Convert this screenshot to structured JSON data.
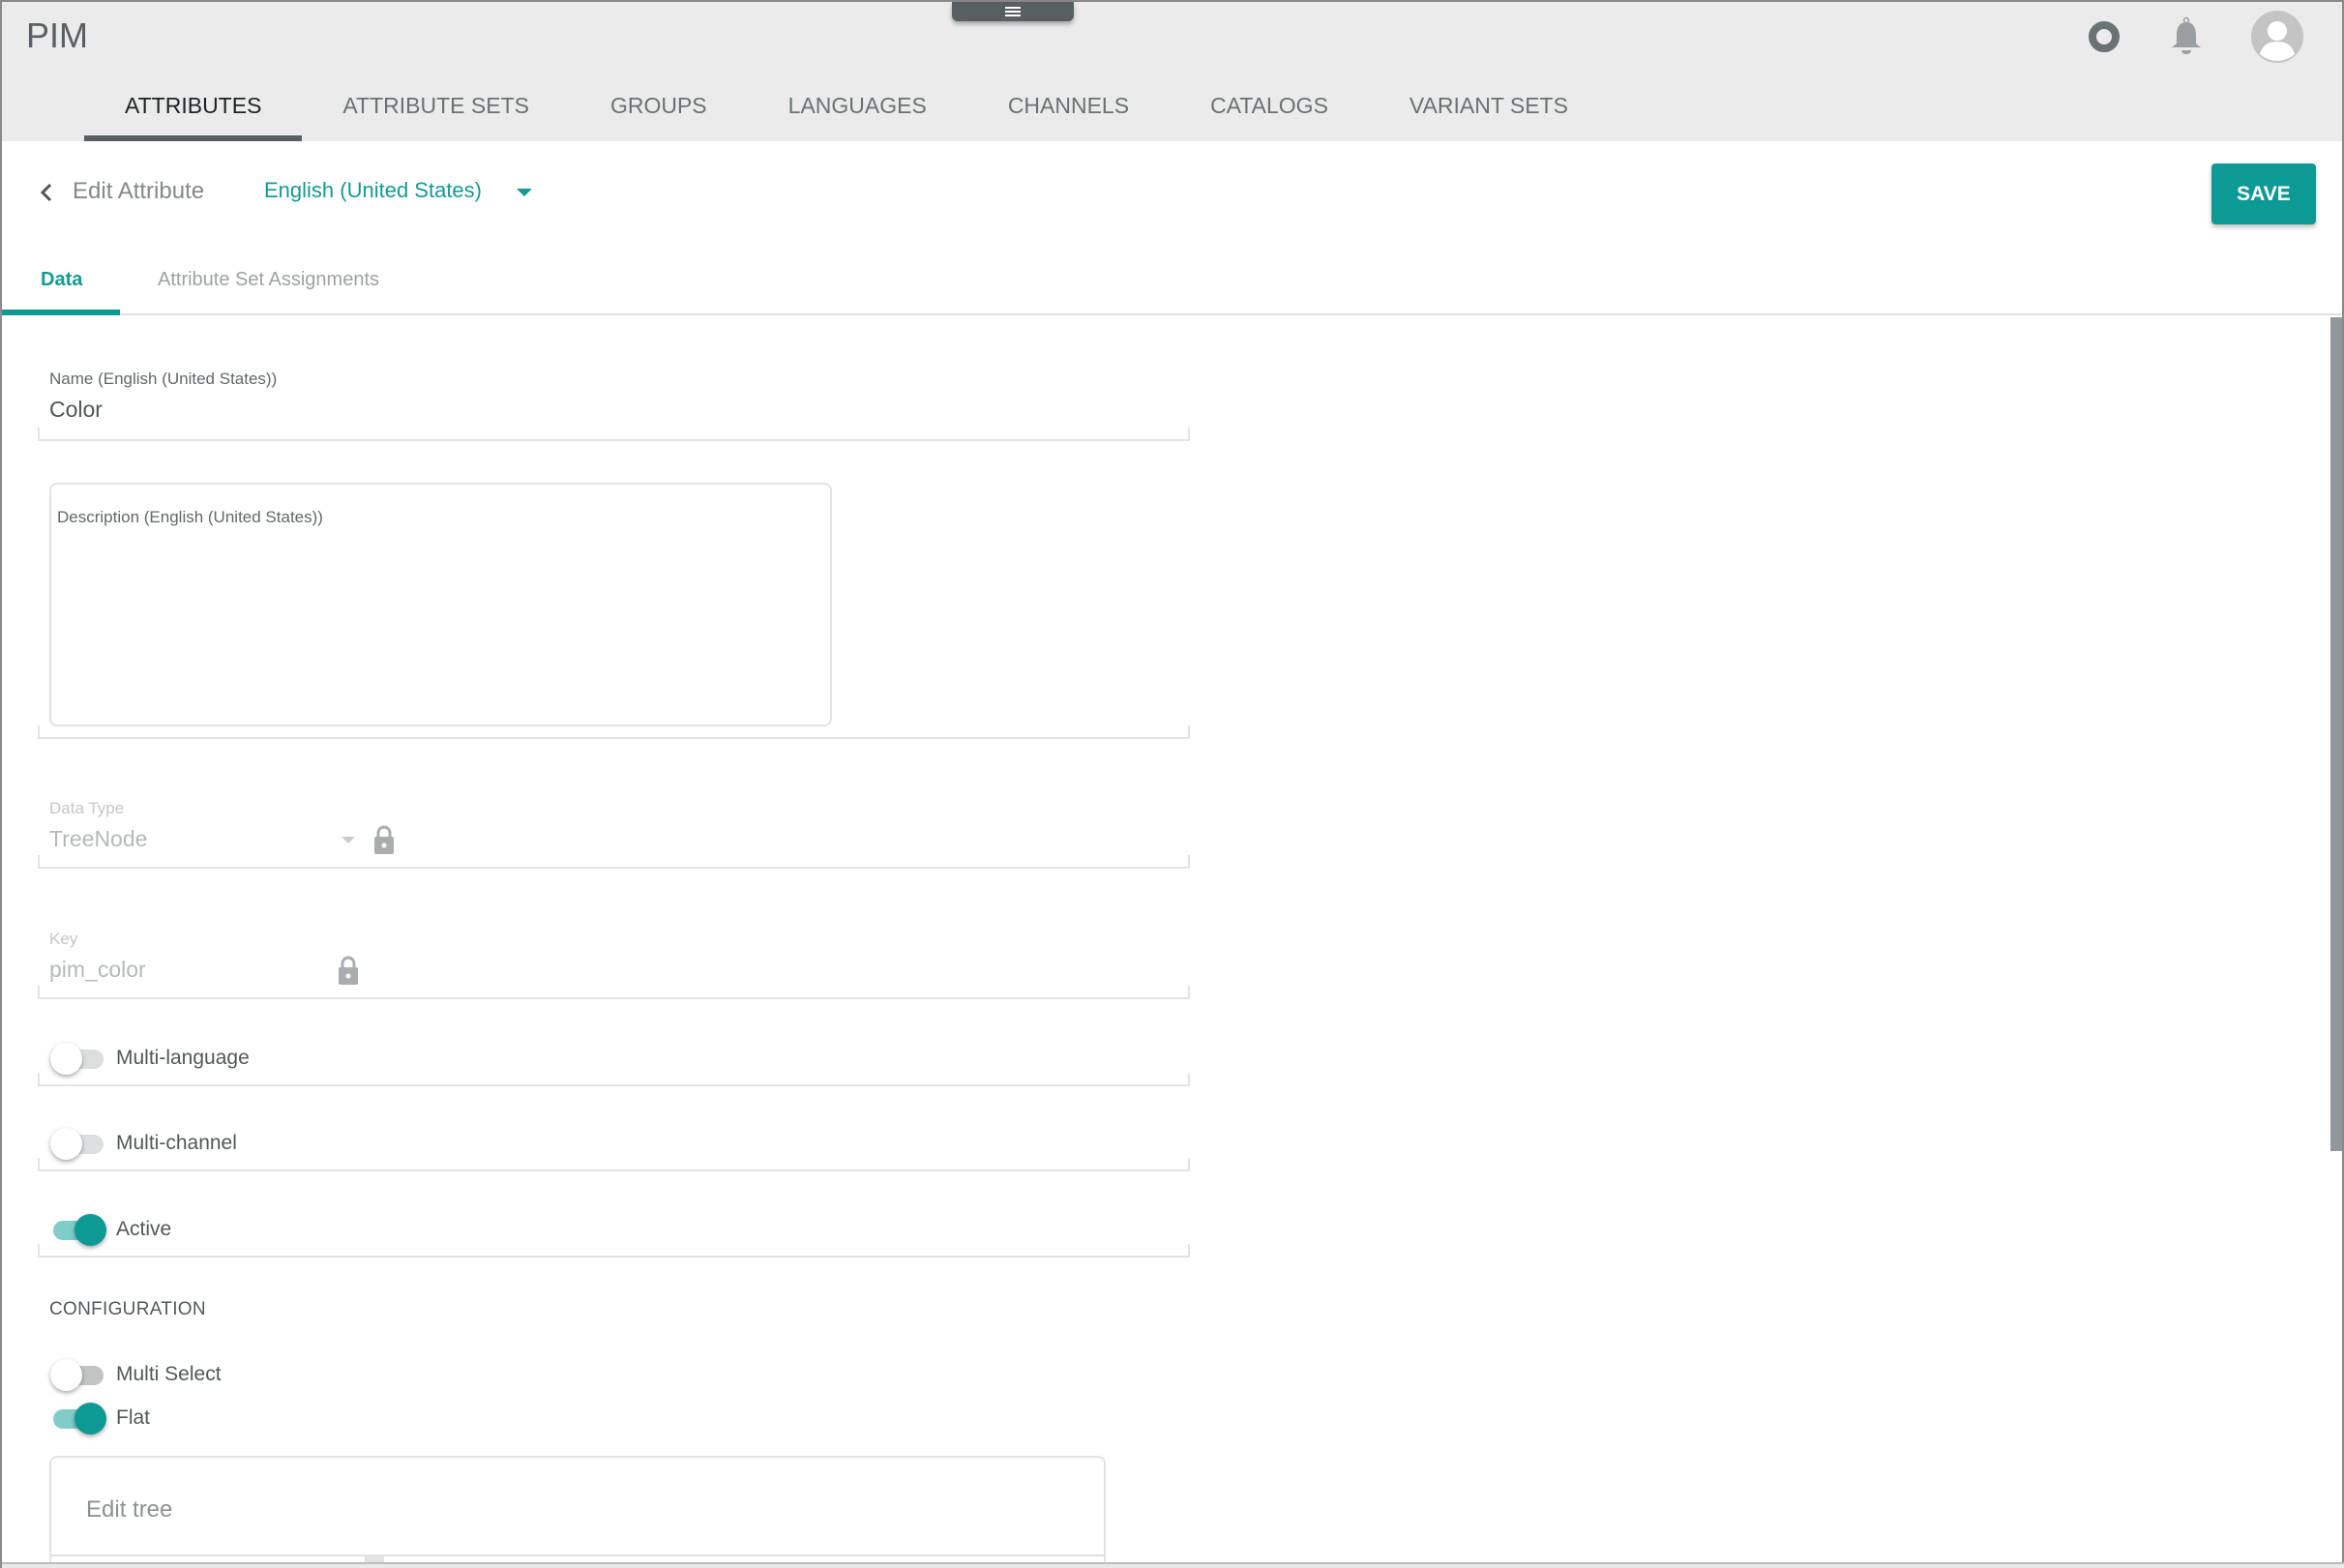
{
  "app": {
    "title": "PIM"
  },
  "header_icons": {
    "status": "status-ring-icon",
    "notifications": "bell-icon",
    "user": "avatar-icon"
  },
  "nav": {
    "tabs": [
      {
        "label": "ATTRIBUTES",
        "active": true
      },
      {
        "label": "ATTRIBUTE SETS",
        "active": false
      },
      {
        "label": "GROUPS",
        "active": false
      },
      {
        "label": "LANGUAGES",
        "active": false
      },
      {
        "label": "CHANNELS",
        "active": false
      },
      {
        "label": "CATALOGS",
        "active": false
      },
      {
        "label": "VARIANT SETS",
        "active": false
      }
    ]
  },
  "page": {
    "title": "Edit Attribute",
    "language": "English (United States)",
    "save_label": "SAVE",
    "tabs": [
      {
        "label": "Data",
        "active": true
      },
      {
        "label": "Attribute Set Assignments",
        "active": false
      }
    ]
  },
  "form": {
    "name": {
      "label": "Name (English (United States))",
      "value": "Color"
    },
    "description": {
      "label": "Description (English (United States))",
      "value": ""
    },
    "data_type": {
      "label": "Data Type",
      "value": "TreeNode",
      "locked": true
    },
    "key": {
      "label": "Key",
      "value": "pim_color",
      "locked": true
    },
    "toggles": [
      {
        "label": "Multi-language",
        "on": false
      },
      {
        "label": "Multi-channel",
        "on": false
      },
      {
        "label": "Active",
        "on": true
      }
    ],
    "configuration": {
      "heading": "CONFIGURATION",
      "toggles": [
        {
          "label": "Multi Select",
          "on": false
        },
        {
          "label": "Flat",
          "on": true
        }
      ],
      "tree_title": "Edit tree"
    }
  },
  "colors": {
    "accent": "#0e9a94",
    "header_bg": "#ebebeb",
    "dark": "#575f61"
  }
}
